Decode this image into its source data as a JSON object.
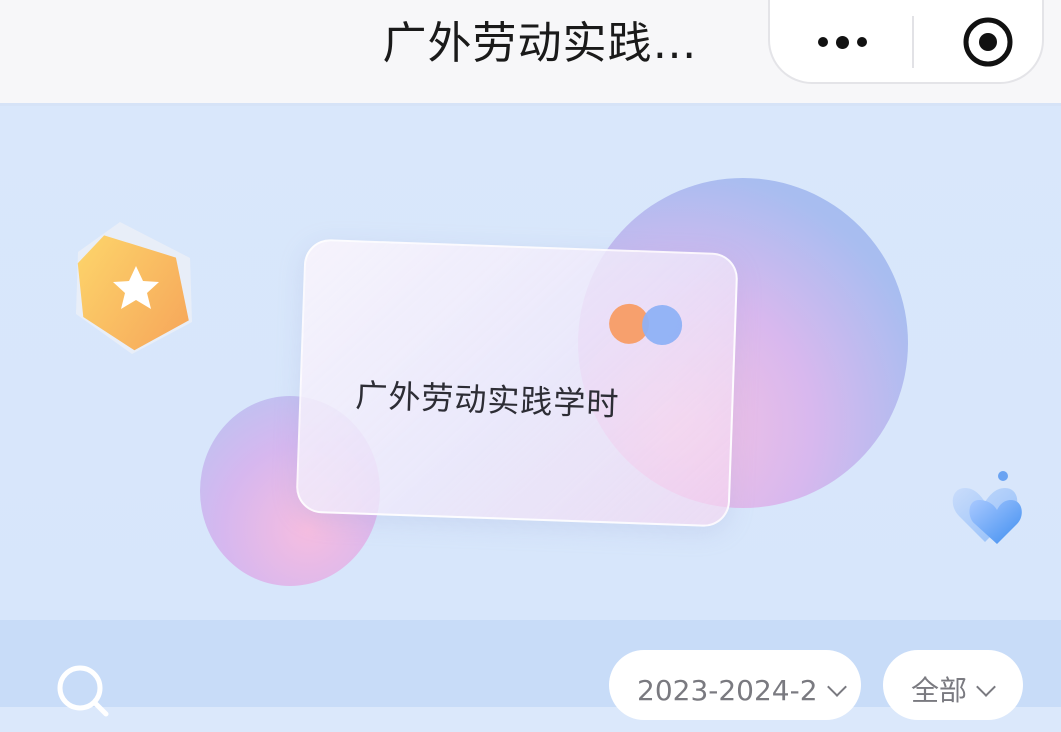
{
  "navbar": {
    "title": "广外劳动实践…",
    "more_icon": "more-dots-icon",
    "close_icon": "target-circle-icon"
  },
  "hero": {
    "card_title": "广外劳动实践学时",
    "badge_icon": "star-badge-icon",
    "heart_icon": "heart-icon",
    "colors": {
      "background": "#d9e7fb",
      "dot_orange": "#f7a06d",
      "dot_blue": "#8fb1f6",
      "badge": "#fbbf5a"
    }
  },
  "filters": {
    "search_icon": "search-icon",
    "term_label": "2023-2024-2",
    "scope_label": "全部"
  }
}
